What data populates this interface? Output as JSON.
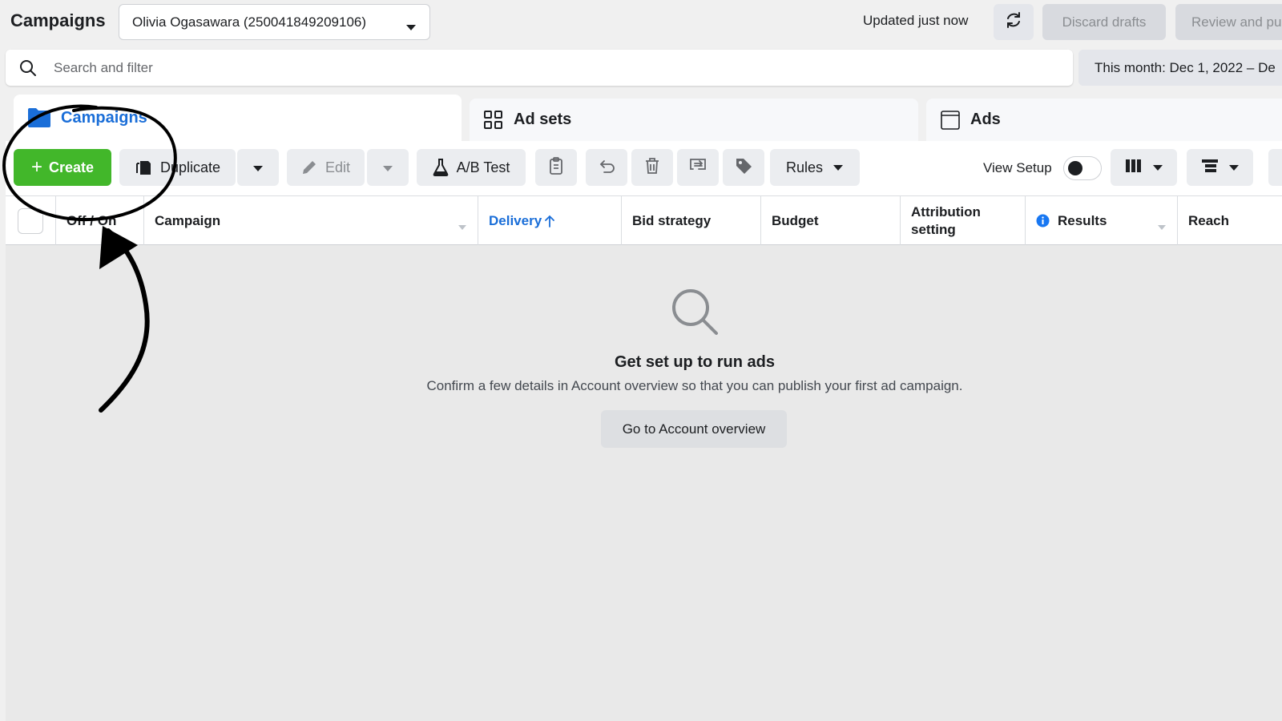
{
  "header": {
    "title": "Campaigns",
    "account": "Olivia Ogasawara (250041849209106)",
    "updated": "Updated just now",
    "discard_label": "Discard drafts",
    "review_label": "Review and pu"
  },
  "search": {
    "placeholder": "Search and filter",
    "date_range": "This month: Dec 1, 2022 – De"
  },
  "tabs": [
    {
      "label": "Campaigns",
      "active": true
    },
    {
      "label": "Ad sets",
      "active": false
    },
    {
      "label": "Ads",
      "active": false
    }
  ],
  "toolbar": {
    "create": "Create",
    "duplicate": "Duplicate",
    "edit": "Edit",
    "ab_test": "A/B Test",
    "rules": "Rules",
    "view_setup": "View Setup",
    "view_setup_on": false
  },
  "table": {
    "columns": [
      "Off / On",
      "Campaign",
      "Delivery",
      "Bid strategy",
      "Budget",
      "Attribution setting",
      "Results",
      "Reach"
    ]
  },
  "empty_state": {
    "title": "Get set up to run ads",
    "description": "Confirm a few details in Account overview so that you can publish your first ad campaign.",
    "button": "Go to Account overview"
  },
  "colors": {
    "create_green": "#42b72a",
    "active_blue": "#1a6ed8",
    "info_blue": "#1877f2"
  }
}
